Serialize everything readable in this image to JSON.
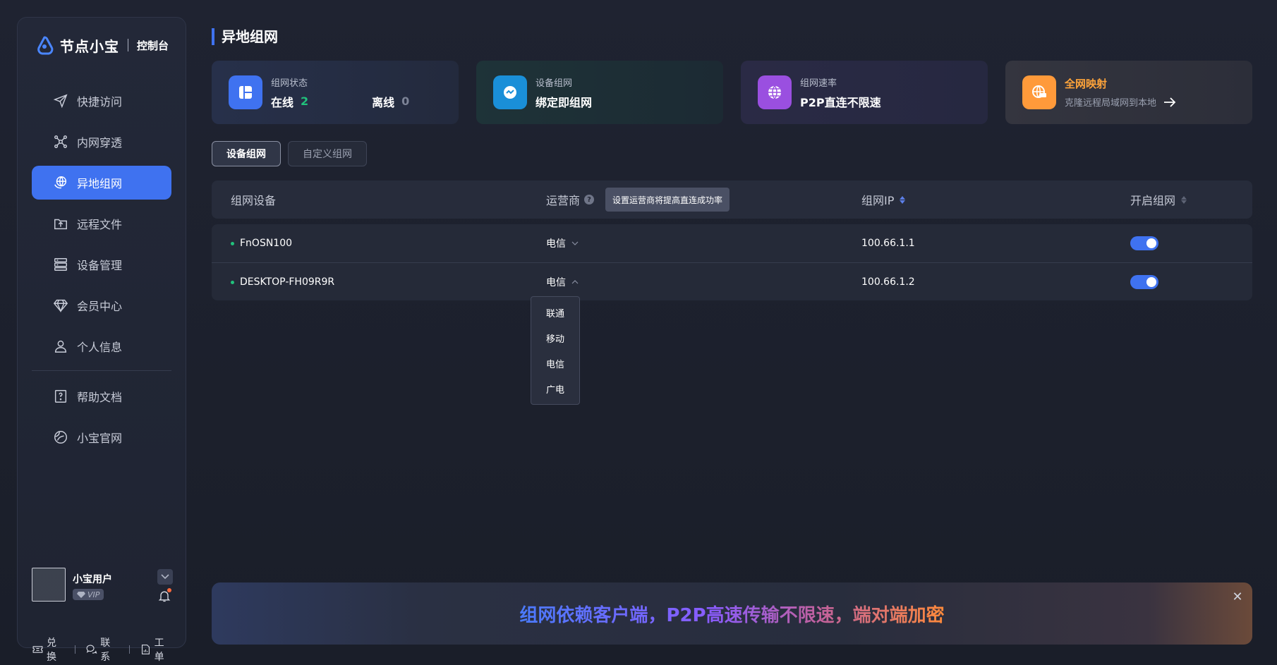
{
  "brand": {
    "name": "节点小宝",
    "sub": "控制台"
  },
  "nav": {
    "items": [
      {
        "label": "快捷访问",
        "icon": "send-icon"
      },
      {
        "label": "内网穿透",
        "icon": "network-icon"
      },
      {
        "label": "异地组网",
        "icon": "globe-hand-icon",
        "active": true
      },
      {
        "label": "远程文件",
        "icon": "folder-upload-icon"
      },
      {
        "label": "设备管理",
        "icon": "server-icon"
      },
      {
        "label": "会员中心",
        "icon": "diamond-icon"
      },
      {
        "label": "个人信息",
        "icon": "user-icon"
      }
    ],
    "extra": [
      {
        "label": "帮助文档",
        "icon": "help-doc-icon"
      },
      {
        "label": "小宝官网",
        "icon": "website-icon"
      }
    ]
  },
  "user": {
    "name": "小宝用户",
    "badge": "VIP"
  },
  "footer": {
    "redeem": "兑换",
    "contact": "联系",
    "ticket": "工单"
  },
  "page": {
    "title": "异地组网"
  },
  "cards": {
    "status": {
      "label": "组网状态",
      "online_label": "在线",
      "online_count": "2",
      "offline_label": "离线",
      "offline_count": "0"
    },
    "device": {
      "label": "设备组网",
      "value": "绑定即组网"
    },
    "speed": {
      "label": "组网速率",
      "value": "P2P直连不限速"
    },
    "mapping": {
      "title": "全网映射",
      "sub": "克隆远程局域网到本地"
    }
  },
  "tabs": {
    "device": "设备组网",
    "custom": "自定义组网"
  },
  "table": {
    "headers": {
      "device": "组网设备",
      "carrier": "运营商",
      "ip": "组网IP",
      "enable": "开启组网"
    },
    "tooltip": "设置运营商将提高直连成功率",
    "rows": [
      {
        "device": "FnOSN100",
        "carrier": "电信",
        "ip": "100.66.1.1",
        "enabled": true
      },
      {
        "device": "DESKTOP-FH09R9R",
        "carrier": "电信",
        "ip": "100.66.1.2",
        "enabled": true
      }
    ]
  },
  "dropdown": {
    "options": [
      "联通",
      "移动",
      "电信",
      "广电"
    ]
  },
  "banner": {
    "text": "组网依赖客户端，P2P高速传输不限速，端对端加密"
  },
  "colors": {
    "accent": "#3f72f0",
    "online": "#21c27c",
    "orange": "#ffa43a"
  }
}
